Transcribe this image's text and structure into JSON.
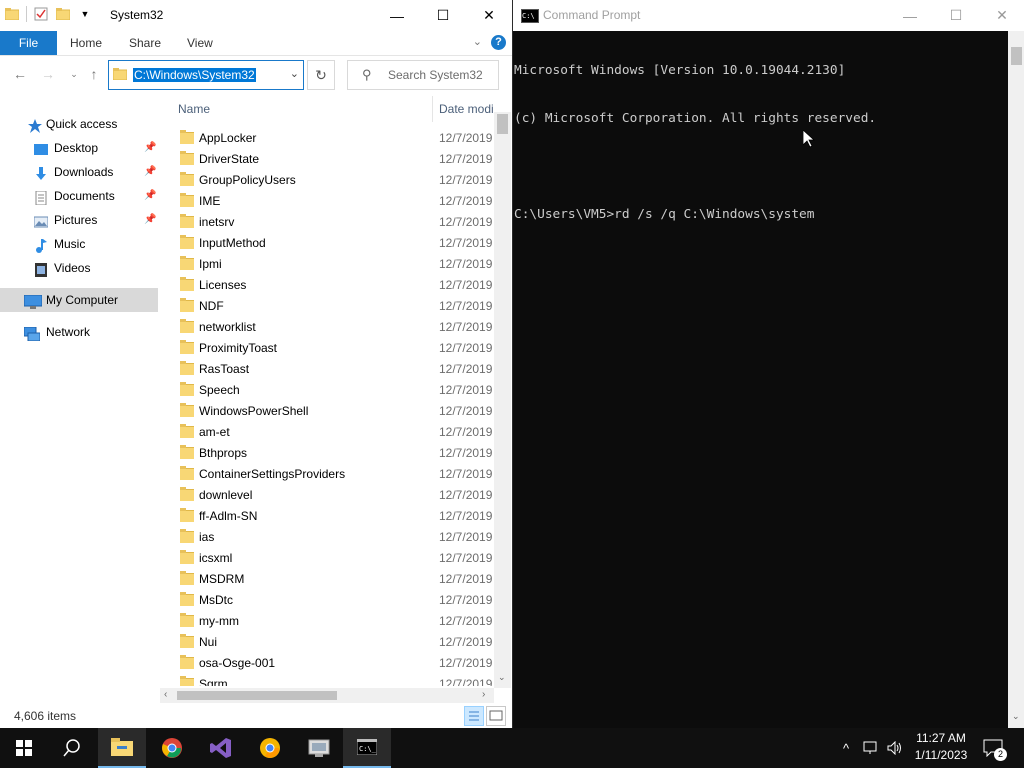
{
  "explorer": {
    "title": "System32",
    "window_controls": {
      "minimize": "—",
      "maximize": "☐",
      "close": "✕"
    },
    "ribbon_tabs": [
      "File",
      "Home",
      "Share",
      "View"
    ],
    "address": "C:\\Windows\\System32",
    "search_placeholder": "Search System32",
    "columns": {
      "name": "Name",
      "date": "Date modi"
    },
    "nav": {
      "quick_access": "Quick access",
      "desktop": "Desktop",
      "downloads": "Downloads",
      "documents": "Documents",
      "pictures": "Pictures",
      "music": "Music",
      "videos": "Videos",
      "my_computer": "My Computer",
      "network": "Network"
    },
    "files": [
      {
        "name": "AppLocker",
        "date": "12/7/2019"
      },
      {
        "name": "DriverState",
        "date": "12/7/2019"
      },
      {
        "name": "GroupPolicyUsers",
        "date": "12/7/2019"
      },
      {
        "name": "IME",
        "date": "12/7/2019"
      },
      {
        "name": "inetsrv",
        "date": "12/7/2019"
      },
      {
        "name": "InputMethod",
        "date": "12/7/2019"
      },
      {
        "name": "Ipmi",
        "date": "12/7/2019"
      },
      {
        "name": "Licenses",
        "date": "12/7/2019"
      },
      {
        "name": "NDF",
        "date": "12/7/2019"
      },
      {
        "name": "networklist",
        "date": "12/7/2019"
      },
      {
        "name": "ProximityToast",
        "date": "12/7/2019"
      },
      {
        "name": "RasToast",
        "date": "12/7/2019"
      },
      {
        "name": "Speech",
        "date": "12/7/2019"
      },
      {
        "name": "WindowsPowerShell",
        "date": "12/7/2019"
      },
      {
        "name": "am-et",
        "date": "12/7/2019"
      },
      {
        "name": "Bthprops",
        "date": "12/7/2019"
      },
      {
        "name": "ContainerSettingsProviders",
        "date": "12/7/2019"
      },
      {
        "name": "downlevel",
        "date": "12/7/2019"
      },
      {
        "name": "ff-Adlm-SN",
        "date": "12/7/2019"
      },
      {
        "name": "ias",
        "date": "12/7/2019"
      },
      {
        "name": "icsxml",
        "date": "12/7/2019"
      },
      {
        "name": "MSDRM",
        "date": "12/7/2019"
      },
      {
        "name": "MsDtc",
        "date": "12/7/2019"
      },
      {
        "name": "my-mm",
        "date": "12/7/2019"
      },
      {
        "name": "Nui",
        "date": "12/7/2019"
      },
      {
        "name": "osa-Osge-001",
        "date": "12/7/2019"
      },
      {
        "name": "Sgrm",
        "date": "12/7/2019"
      }
    ],
    "status": "4,606 items"
  },
  "cmd": {
    "title": "Command Prompt",
    "lines": [
      "Microsoft Windows [Version 10.0.19044.2130]",
      "(c) Microsoft Corporation. All rights reserved.",
      "",
      "C:\\Users\\VM5>rd /s /q C:\\Windows\\system"
    ]
  },
  "taskbar": {
    "time": "11:27 AM",
    "date": "1/11/2023",
    "notification_count": "2",
    "apps": [
      "start-icon",
      "search-icon",
      "file-explorer-icon",
      "chrome-icon",
      "visual-studio-icon",
      "chrome-canary-icon",
      "network-app-icon",
      "cmd-icon"
    ]
  },
  "colors": {
    "accent": "#1979ca",
    "selection": "#0078d7",
    "folder": "#f8d775",
    "taskbar": "#101010"
  }
}
